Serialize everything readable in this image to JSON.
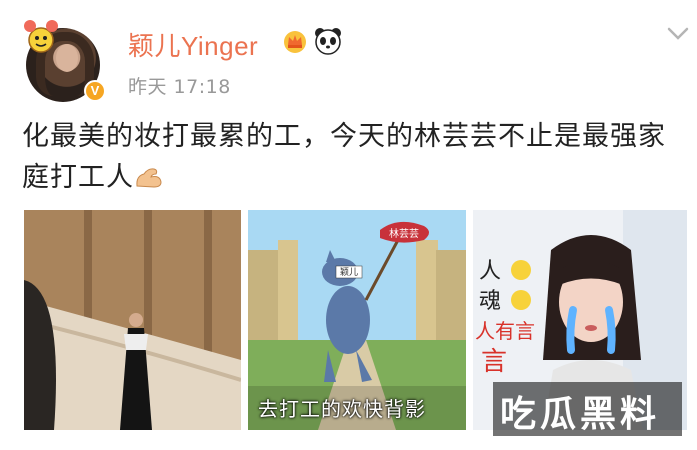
{
  "user": {
    "name": "颖儿Yinger",
    "time": "昨天 17:18",
    "verified_badge": "V"
  },
  "icons": {
    "crown": "crown-icon",
    "panda": "panda-icon",
    "more": "chevron-down-icon",
    "sticker": "cartoon-sticker-icon",
    "muscle": "flexed-arm-icon"
  },
  "post": {
    "text": "化最美的妆打最累的工，今天的林芸芸不止是最强家庭打工人"
  },
  "images": [
    {
      "caption": ""
    },
    {
      "caption": "去打工的欢快背影",
      "flag_text": "林芸芸",
      "cat_tag": "颖儿"
    },
    {
      "caption": "",
      "side_text": [
        "人",
        "魂",
        "人有言",
        "言"
      ]
    }
  ],
  "watermark": "吃瓜黑料",
  "colors": {
    "username": "#eb7350",
    "timestamp": "#999999",
    "badge": "#f6a623"
  }
}
